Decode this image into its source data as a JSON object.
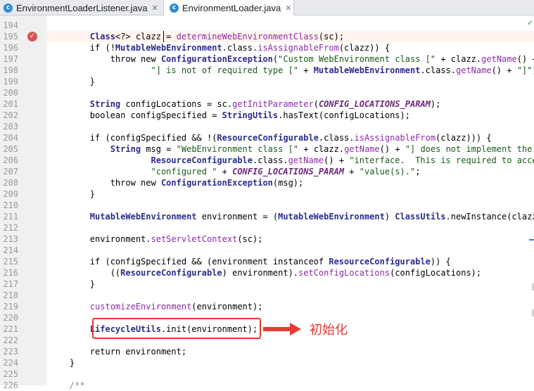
{
  "tabs": [
    {
      "label": "EnvironmentLoaderListener.java",
      "icon": "class-icon",
      "icon_glyph": "c"
    },
    {
      "label": "EnvironmentLoader.java",
      "icon": "class-icon",
      "icon_glyph": "c"
    }
  ],
  "lines": [
    {
      "n": "194",
      "code": ""
    },
    {
      "n": "195",
      "code": "        Class<?> clazz = determineWebEnvironmentClass(sc);"
    },
    {
      "n": "196",
      "code": "        if (!MutableWebEnvironment.class.isAssignableFrom(clazz)) {"
    },
    {
      "n": "197",
      "code": "            throw new ConfigurationException(\"Custom WebEnvironment class [\" + clazz.getName() +"
    },
    {
      "n": "198",
      "code": "                    \"] is not of required type [\" + MutableWebEnvironment.class.getName() + \"]\");"
    },
    {
      "n": "199",
      "code": "        }"
    },
    {
      "n": "200",
      "code": ""
    },
    {
      "n": "201",
      "code": "        String configLocations = sc.getInitParameter(CONFIG_LOCATIONS_PARAM);"
    },
    {
      "n": "202",
      "code": "        boolean configSpecified = StringUtils.hasText(configLocations);"
    },
    {
      "n": "203",
      "code": ""
    },
    {
      "n": "204",
      "code": "        if (configSpecified && !(ResourceConfigurable.class.isAssignableFrom(clazz))) {"
    },
    {
      "n": "205",
      "code": "            String msg = \"WebEnvironment class [\" + clazz.getName() + \"] does not implement the \""
    },
    {
      "n": "206",
      "code": "                    ResourceConfigurable.class.getName() + \"interface.  This is required to accept"
    },
    {
      "n": "207",
      "code": "                    \"configured \" + CONFIG_LOCATIONS_PARAM + \"value(s).\";"
    },
    {
      "n": "208",
      "code": "            throw new ConfigurationException(msg);"
    },
    {
      "n": "209",
      "code": "        }"
    },
    {
      "n": "210",
      "code": ""
    },
    {
      "n": "211",
      "code": "        MutableWebEnvironment environment = (MutableWebEnvironment) ClassUtils.newInstance(clazz)"
    },
    {
      "n": "212",
      "code": ""
    },
    {
      "n": "213",
      "code": "        environment.setServletContext(sc);"
    },
    {
      "n": "214",
      "code": ""
    },
    {
      "n": "215",
      "code": "        if (configSpecified && (environment instanceof ResourceConfigurable)) {"
    },
    {
      "n": "216",
      "code": "            ((ResourceConfigurable) environment).setConfigLocations(configLocations);"
    },
    {
      "n": "217",
      "code": "        }"
    },
    {
      "n": "218",
      "code": ""
    },
    {
      "n": "219",
      "code": "        customizeEnvironment(environment);"
    },
    {
      "n": "220",
      "code": ""
    },
    {
      "n": "221",
      "code": "        LifecycleUtils.init(environment);"
    },
    {
      "n": "222",
      "code": ""
    },
    {
      "n": "223",
      "code": "        return environment;"
    },
    {
      "n": "224",
      "code": "    }"
    },
    {
      "n": "225",
      "code": ""
    },
    {
      "n": "226",
      "code": "    /**"
    }
  ],
  "annotation": {
    "label": "初始化",
    "color": "#e53935"
  },
  "colors": {
    "keyword": "#000000",
    "class": "#2c2c8f",
    "string": "#1a5a1a",
    "method": "#8c2aa8",
    "field": "#6d2a7a"
  }
}
